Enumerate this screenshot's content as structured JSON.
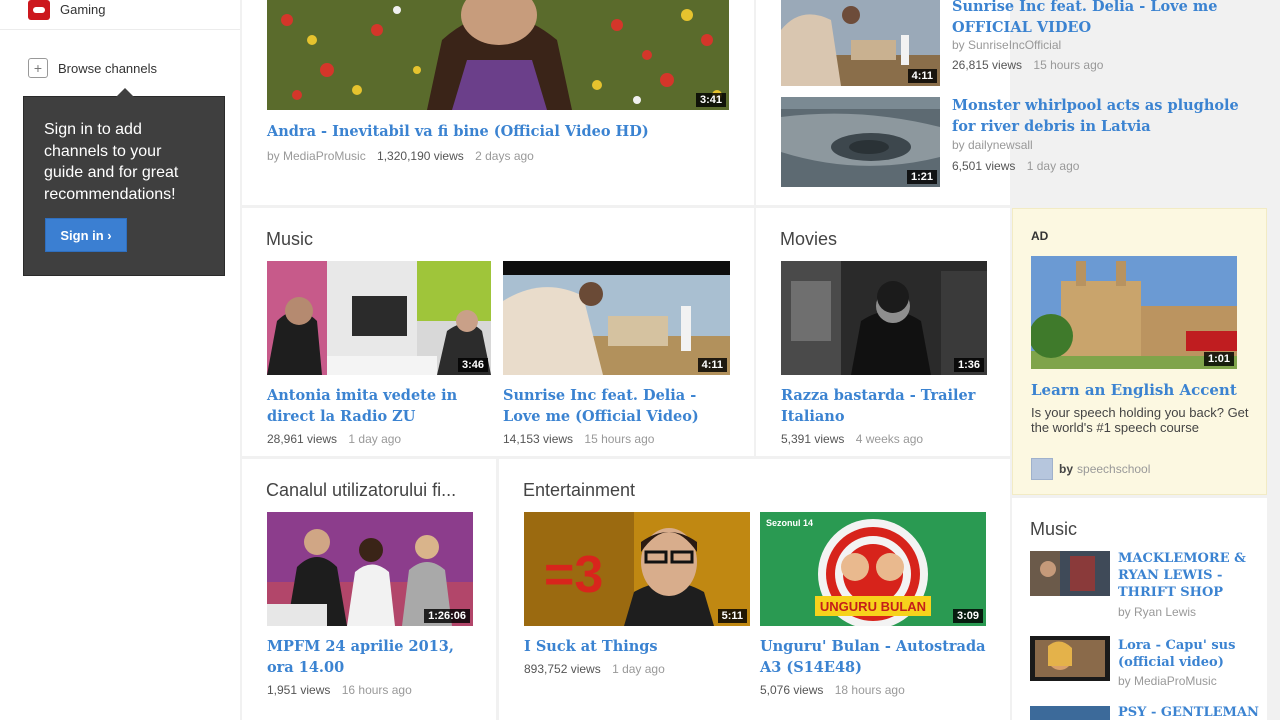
{
  "sidebar": {
    "gaming_label": "Gaming",
    "browse_label": "Browse channels",
    "tooltip_text": "Sign in to add channels to your guide and for great recommendations!",
    "signin_label": "Sign in ›"
  },
  "top_feature": {
    "title": "Andra - Inevitabil va fi bine (Official Video HD)",
    "by": "by MediaProMusic",
    "views": "1,320,190 views",
    "ago": "2 days ago",
    "duration": "3:41"
  },
  "top_right": [
    {
      "title": "Sunrise Inc feat. Delia - Love me OFFICIAL VIDEO",
      "by": "by SunriseIncOfficial",
      "views": "26,815 views",
      "ago": "15 hours ago",
      "duration": "4:11"
    },
    {
      "title": "Monster whirlpool acts as plughole for river debris in Latvia",
      "by": "by dailynewsall",
      "views": "6,501 views",
      "ago": "1 day ago",
      "duration": "1:21"
    }
  ],
  "music": {
    "title": "Music",
    "videos": [
      {
        "title": "Antonia imita vedete in direct la Radio ZU",
        "views": "28,961 views",
        "ago": "1 day ago",
        "duration": "3:46"
      },
      {
        "title": "Sunrise Inc feat. Delia - Love me (Official Video)",
        "views": "14,153 views",
        "ago": "15 hours ago",
        "duration": "4:11"
      }
    ]
  },
  "movies": {
    "title": "Movies",
    "video": {
      "title": "Razza bastarda - Trailer Italiano",
      "views": "5,391 views",
      "ago": "4 weeks ago",
      "duration": "1:36"
    }
  },
  "channel": {
    "title": "Canalul utilizatorului fi...",
    "video": {
      "title": "MPFM 24 aprilie 2013, ora 14.00",
      "views": "1,951 views",
      "ago": "16 hours ago",
      "duration": "1:26:06"
    }
  },
  "entertainment": {
    "title": "Entertainment",
    "videos": [
      {
        "title": "I Suck at Things",
        "views": "893,752 views",
        "ago": "1 day ago",
        "duration": "5:11"
      },
      {
        "title": "Unguru' Bulan - Autostrada A3 (S14E48)",
        "views": "5,076 views",
        "ago": "18 hours ago",
        "duration": "3:09"
      }
    ]
  },
  "ad": {
    "label": "AD",
    "title": "Learn an English Accent",
    "description": "Is your speech holding you back? Get the world's #1 speech course",
    "by": "by",
    "channel": "speechschool",
    "duration": "1:01"
  },
  "right_music": {
    "title": "Music",
    "items": [
      {
        "title": "MACKLEMORE & RYAN LEWIS - THRIFT SHOP",
        "by": "by Ryan Lewis"
      },
      {
        "title": "Lora - Capu' sus (official video)",
        "by": "by MediaProMusic"
      },
      {
        "title": "PSY - GENTLEMAN",
        "by": ""
      }
    ]
  },
  "colors": {
    "link": "#3b83d1",
    "accent": "#cc181e",
    "button": "#3b7fd2"
  },
  "thumb_text": {
    "ep_banner": "Sezonul 14",
    "ep_logo": "UNGURU BULAN",
    "eq_text": "=3"
  }
}
